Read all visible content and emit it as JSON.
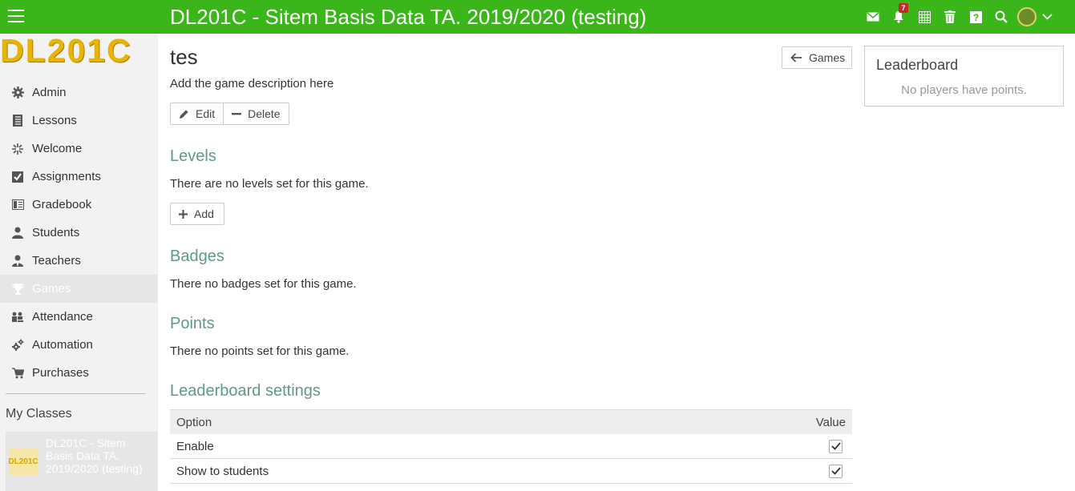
{
  "header": {
    "title": "DL201C - Sitem Basis Data TA. 2019/2020 (testing)",
    "notification_count": "7",
    "accent_color": "#3bb61a"
  },
  "sidebar": {
    "logo_text": "DL201C",
    "items": [
      {
        "label": "Admin",
        "icon": "gear-icon"
      },
      {
        "label": "Lessons",
        "icon": "notebook-icon"
      },
      {
        "label": "Welcome",
        "icon": "sparkle-icon"
      },
      {
        "label": "Assignments",
        "icon": "checkbox-icon"
      },
      {
        "label": "Gradebook",
        "icon": "gradebook-icon"
      },
      {
        "label": "Students",
        "icon": "person-icon"
      },
      {
        "label": "Teachers",
        "icon": "teacher-icon"
      },
      {
        "label": "Games",
        "icon": "trophy-icon",
        "active": true
      },
      {
        "label": "Attendance",
        "icon": "group-icon"
      },
      {
        "label": "Automation",
        "icon": "gears-icon"
      },
      {
        "label": "Purchases",
        "icon": "cart-icon"
      }
    ],
    "my_classes_label": "My Classes",
    "class_item": {
      "name": "DL201C - Sitem Basis Data TA. 2019/2020 (testing)",
      "logo_text": "DL201C"
    }
  },
  "main": {
    "game_title": "tes",
    "game_description": "Add the game description here",
    "edit_label": "Edit",
    "delete_label": "Delete",
    "games_button_label": "Games",
    "levels": {
      "title": "Levels",
      "text": "There are no levels set for this game.",
      "add_label": "Add"
    },
    "badges": {
      "title": "Badges",
      "text": "There no badges set for this game."
    },
    "points": {
      "title": "Points",
      "text": "There no points set for this game."
    },
    "leaderboard_settings": {
      "title": "Leaderboard settings",
      "col_option": "Option",
      "col_value": "Value",
      "rows": [
        {
          "option": "Enable",
          "checked": true
        },
        {
          "option": "Show to students",
          "checked": true
        }
      ]
    }
  },
  "leaderboard": {
    "title": "Leaderboard",
    "empty_text": "No players have points."
  }
}
